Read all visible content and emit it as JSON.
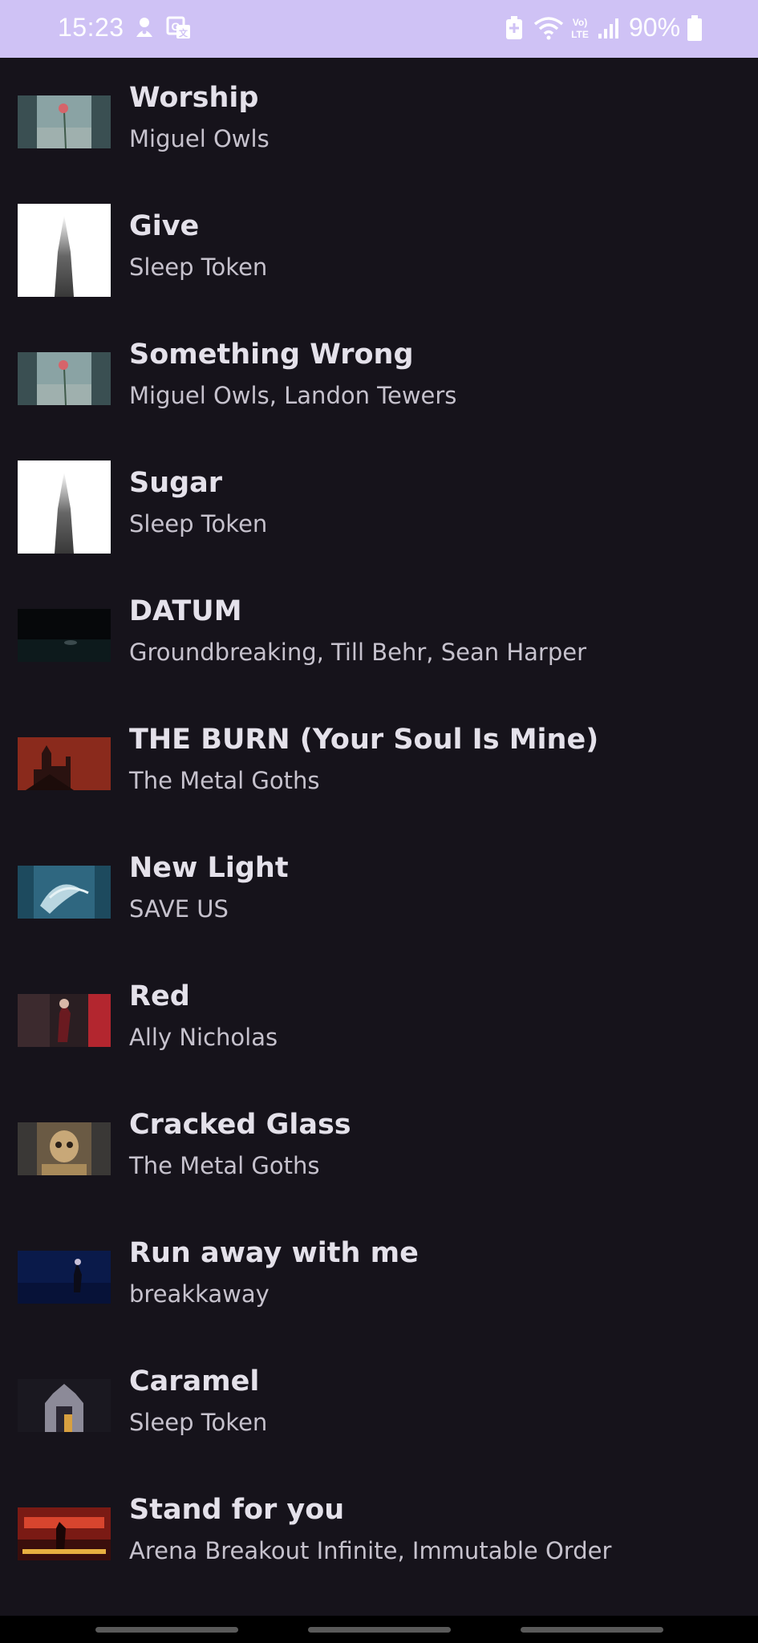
{
  "status_bar": {
    "time": "15:23",
    "battery": "90%",
    "icons": [
      "notification-alert-icon",
      "translate-icon",
      "battery-saver-icon",
      "wifi-icon",
      "volte-icon",
      "signal-icon",
      "battery-icon"
    ]
  },
  "songs": [
    {
      "title": "Worship",
      "artist": "Miguel Owls",
      "thumb": "rose-art"
    },
    {
      "title": "Give",
      "artist": "Sleep Token",
      "thumb": "white-figure-art"
    },
    {
      "title": "Something Wrong",
      "artist": "Miguel Owls, Landon Tewers",
      "thumb": "rose-art"
    },
    {
      "title": "Sugar",
      "artist": "Sleep Token",
      "thumb": "white-figure-art"
    },
    {
      "title": "DATUM",
      "artist": "Groundbreaking, Till Behr, Sean Harper",
      "thumb": "dark-landscape-art"
    },
    {
      "title": "THE BURN (Your Soul Is Mine)",
      "artist": "The Metal Goths",
      "thumb": "red-castle-art"
    },
    {
      "title": "New Light",
      "artist": "SAVE US",
      "thumb": "blue-wave-art"
    },
    {
      "title": "Red",
      "artist": "Ally Nicholas",
      "thumb": "red-stage-art"
    },
    {
      "title": "Cracked Glass",
      "artist": "The Metal Goths",
      "thumb": "skull-art"
    },
    {
      "title": "Run away with me",
      "artist": "breakkaway",
      "thumb": "blue-night-art"
    },
    {
      "title": "Caramel",
      "artist": "Sleep Token",
      "thumb": "cathedral-art"
    },
    {
      "title": "Stand for you",
      "artist": "Arena Breakout Infinite, Immutable Order",
      "thumb": "stand-poster-art"
    }
  ],
  "colors": {
    "background": "#16131b",
    "status_bar": "#cfc2f5",
    "title_text": "#e4e1ea",
    "artist_text": "#c6c2cd"
  }
}
